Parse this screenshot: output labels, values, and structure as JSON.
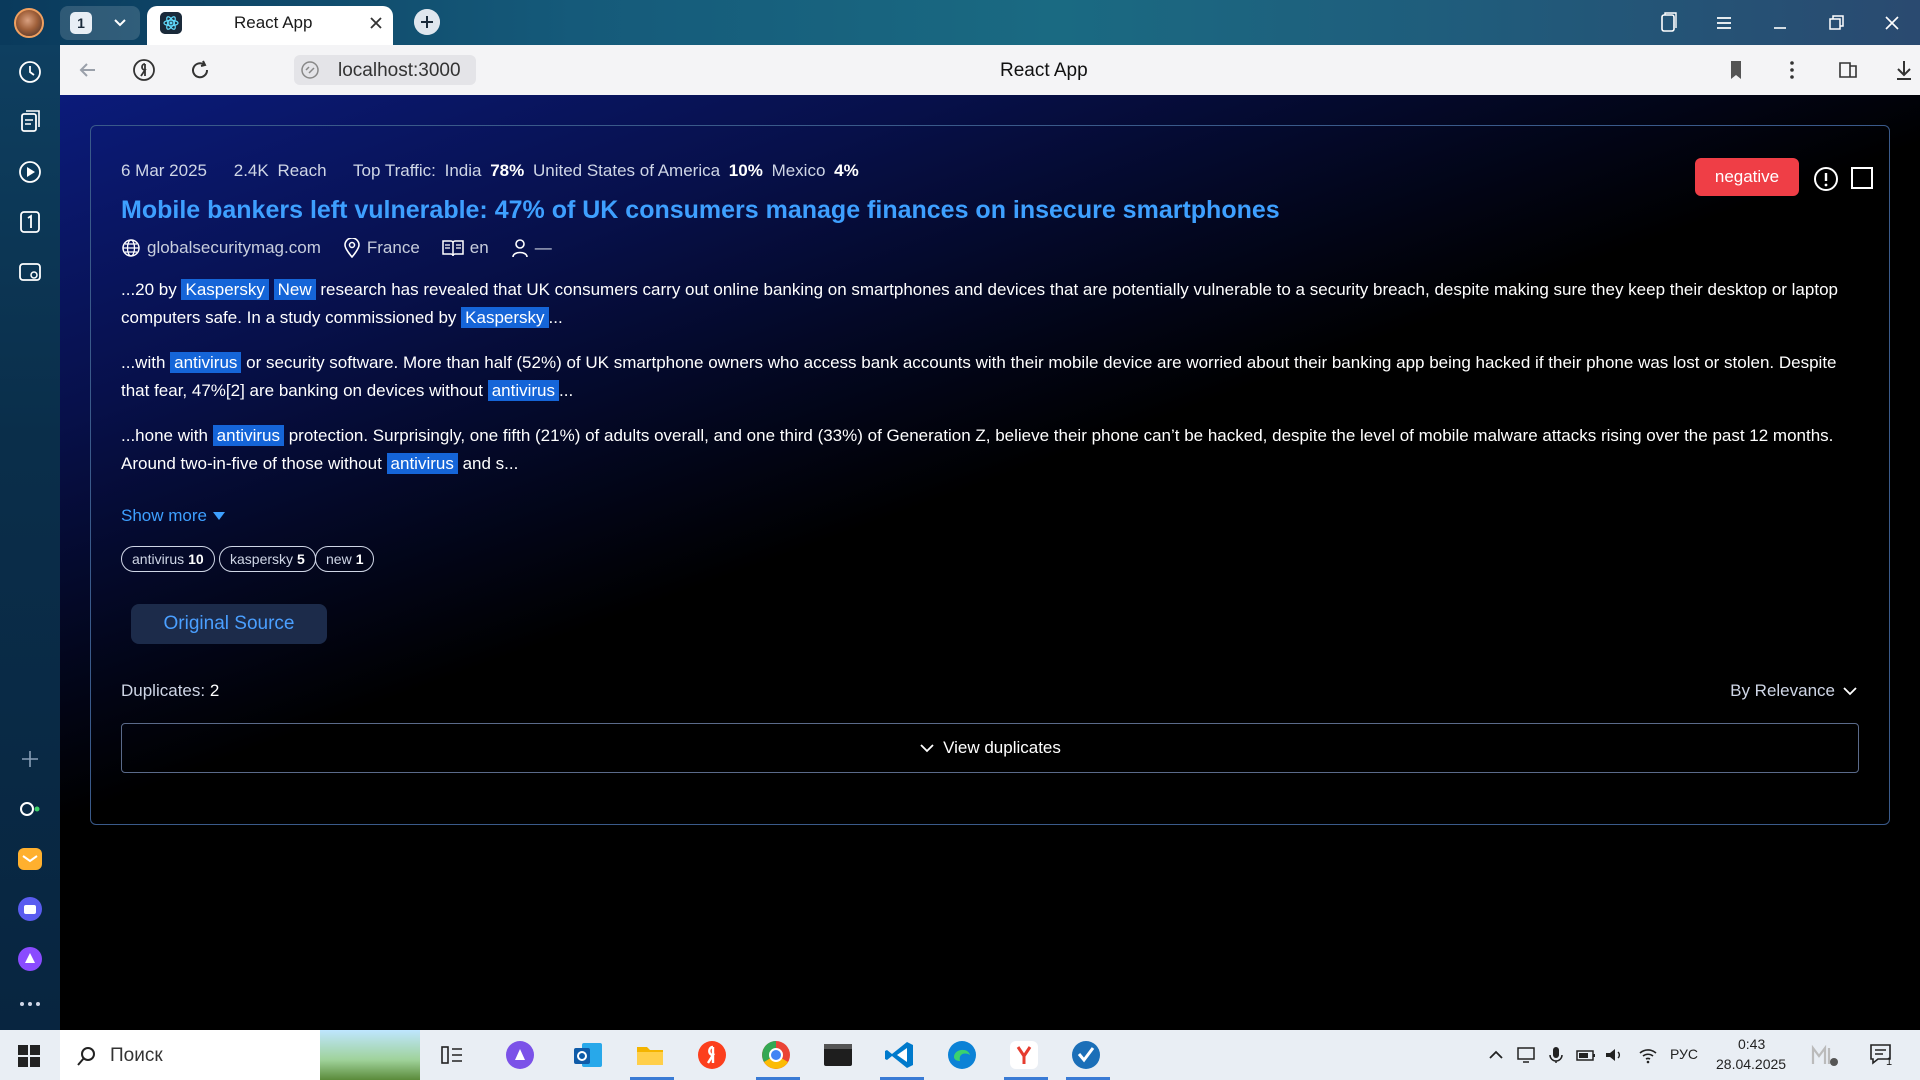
{
  "browser": {
    "tab_count": "1",
    "tab_title": "React App",
    "url": "localhost:3000",
    "page_title": "React App"
  },
  "article": {
    "date": "6 Mar 2025",
    "reach_value": "2.4K",
    "reach_label": "Reach",
    "top_traffic_label": "Top Traffic:",
    "traffic": [
      {
        "country": "India",
        "pct": "78%"
      },
      {
        "country": "United States of America",
        "pct": "10%"
      },
      {
        "country": "Mexico",
        "pct": "4%"
      }
    ],
    "title": "Mobile bankers left vulnerable: 47% of UK consumers manage finances on insecure smartphones",
    "source_domain": "globalsecuritymag.com",
    "location": "France",
    "language": "en",
    "author": "—",
    "sentiment": "negative",
    "snippets": [
      {
        "p1": "...20 by ",
        "h1": "Kaspersky",
        "h2": "New",
        "p2": " research has revealed that UK consumers carry out online banking on smartphones and devices that are potentially vulnerable to a security breach, despite making sure they keep their desktop or laptop computers safe. In a study commissioned by ",
        "h3": "Kaspersky",
        "p3": "..."
      },
      {
        "p1": "...with ",
        "h1": "antivirus",
        "p2": " or security software. More than half (52%) of UK smartphone owners who access bank accounts with their mobile device are worried about their banking app being hacked if their phone was lost or stolen. Despite that fear, 47%[2] are banking on devices without ",
        "h2": "antivirus",
        "p3": "..."
      },
      {
        "p1": "...hone with ",
        "h1": "antivirus",
        "p2": " protection. Surprisingly, one fifth (21%) of adults overall, and one third (33%) of Generation Z, believe their phone can’t be hacked, despite the level of mobile malware attacks rising over the past 12 months. Around two-in-five of those without ",
        "h2": "antivirus",
        "p3": " and s..."
      }
    ],
    "show_more": "Show more",
    "tags": [
      {
        "label": "antivirus",
        "count": "10"
      },
      {
        "label": "kaspersky",
        "count": "5"
      },
      {
        "label": "new",
        "count": "1"
      }
    ],
    "original_source": "Original Source",
    "duplicates_label": "Duplicates:",
    "duplicates_count": "2",
    "sort_label": "By Relevance",
    "view_duplicates": "View duplicates"
  },
  "taskbar": {
    "search_placeholder": "Поиск",
    "language": "РУС",
    "time": "0:43",
    "date": "28.04.2025",
    "notification_count": "1"
  },
  "colors": {
    "accent_blue": "#3ea0ff",
    "highlight": "#1565d8",
    "sentiment_negative": "#ef3e46"
  }
}
